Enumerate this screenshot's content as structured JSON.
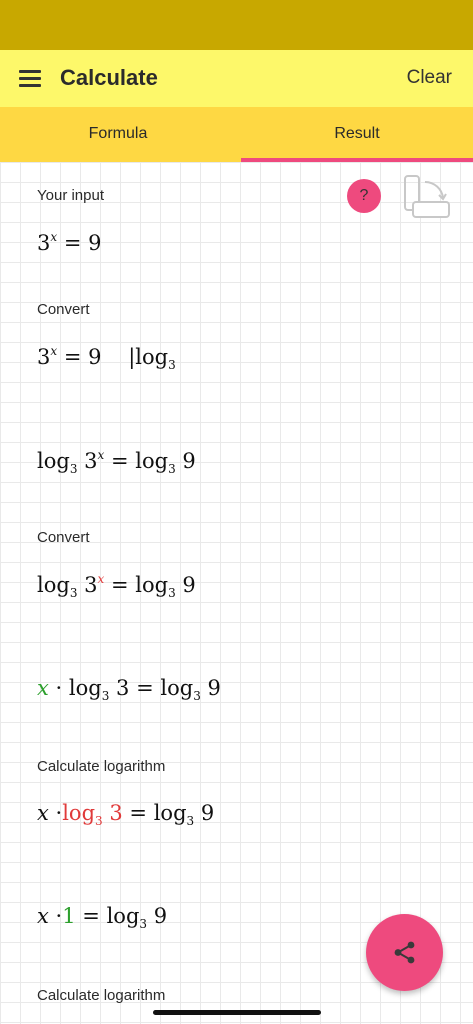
{
  "app_bar": {
    "title": "Calculate",
    "clear_label": "Clear",
    "menu_icon": "hamburger-menu-icon"
  },
  "tabs": [
    {
      "label": "Formula"
    },
    {
      "label": "Result",
      "active": true
    }
  ],
  "colors": {
    "status_bar": "#c8a800",
    "app_bar": "#fdf86a",
    "tabs": "#fed843",
    "accent": "#ee4a7e",
    "highlight_red": "#e03a3a",
    "highlight_green": "#2ea02e"
  },
  "toolbar": {
    "help_label": "?",
    "rotate_icon": "rotate-device-icon"
  },
  "steps": [
    {
      "label": "Your input",
      "equation": "3^x = 9"
    },
    {
      "label": "Convert",
      "equation": "3^x = 9 | log_3",
      "result": "log_3 3^x = log_3 9"
    },
    {
      "label": "Convert",
      "equation": "log_3 3^x = log_3 9",
      "result": "x · log_3 3 = log_3 9"
    },
    {
      "label": "Calculate logarithm",
      "equation": "x · log_3 3 = log_3 9",
      "result": "x · 1 = log_3 9"
    },
    {
      "label": "Calculate logarithm"
    }
  ],
  "math_text": {
    "three": "3",
    "nine": "9",
    "one": "1",
    "x": "x",
    "log": "log",
    "base": "3",
    "eq": "=",
    "dot": "·",
    "bar": "|"
  },
  "fab": {
    "icon": "share-icon"
  }
}
